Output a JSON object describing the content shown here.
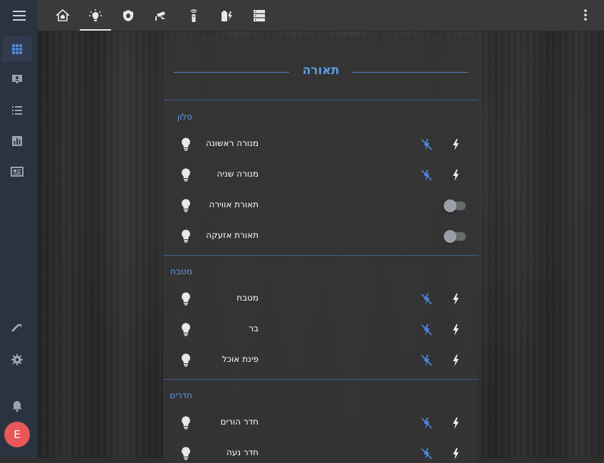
{
  "colors": {
    "accent": "#5b9de0",
    "icon": "#e8e8e8",
    "sidebar_icon": "#9aa3b2",
    "sidebar_active_icon": "#4e86d8",
    "avatar_bg": "#e8575a"
  },
  "sidebar": {
    "items": [
      {
        "icon": "grid-icon",
        "active": true
      },
      {
        "icon": "map-marker-icon",
        "active": false
      },
      {
        "icon": "list-icon",
        "active": false
      },
      {
        "icon": "chart-icon",
        "active": false
      },
      {
        "icon": "media-icon",
        "active": false
      }
    ],
    "bottom": [
      {
        "icon": "hammer-icon"
      },
      {
        "icon": "gear-icon"
      },
      {
        "icon": "bell-icon"
      }
    ],
    "avatar_initial": "E"
  },
  "topbar": {
    "tabs": [
      {
        "icon": "home-icon",
        "active": false
      },
      {
        "icon": "lightbulb-icon",
        "active": true
      },
      {
        "icon": "shield-home-icon",
        "active": false
      },
      {
        "icon": "cctv-icon",
        "active": false
      },
      {
        "icon": "remote-icon",
        "active": false
      },
      {
        "icon": "battery-charging-icon",
        "active": false
      },
      {
        "icon": "server-icon",
        "active": false
      }
    ],
    "menu_icon": "dots-vertical-icon"
  },
  "card": {
    "title": "תאורה",
    "sections": [
      {
        "title": "סלון",
        "rows": [
          {
            "name": "מנורה ראשונה",
            "control": "buttons"
          },
          {
            "name": "מנורה שניה",
            "control": "buttons"
          },
          {
            "name": "תאורת אווירה",
            "control": "toggle",
            "state": "off"
          },
          {
            "name": "תאורת אזעקה",
            "control": "toggle",
            "state": "off"
          }
        ]
      },
      {
        "title": "מטבח",
        "rows": [
          {
            "name": "מטבח",
            "control": "buttons"
          },
          {
            "name": "בר",
            "control": "buttons"
          },
          {
            "name": "פינת אוכל",
            "control": "buttons"
          }
        ]
      },
      {
        "title": "חדרים",
        "rows": [
          {
            "name": "חדר הורים",
            "control": "buttons"
          },
          {
            "name": "חדר נעה",
            "control": "buttons"
          }
        ]
      }
    ]
  }
}
